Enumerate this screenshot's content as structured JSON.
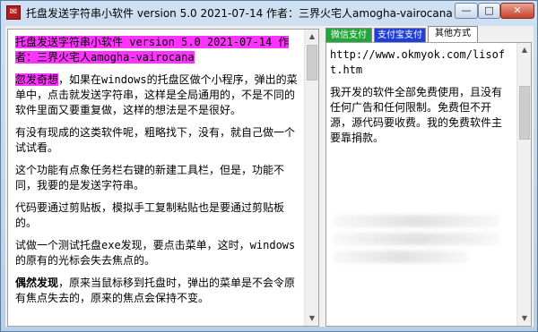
{
  "window": {
    "title": "托盘发送字符串小软件   version 5.0   2021-07-14   作者：三界火宅人amogha-vairocana",
    "icon_name": "app-icon",
    "minimize_glyph": "—",
    "maximize_glyph": "□",
    "close_glyph": "✕"
  },
  "left": {
    "header": "托盘发送字符串小软件     version 5.0    2021-07-14    作者：三界火宅人amogha-vairocana",
    "p1_lead": "忽发奇想",
    "p1_rest": "，如果在windows的托盘区做个小程序，弹出的菜单中，点击就发送字符串，这样是全局通用的，不是不同的软件里面又要重复做，这样的想法是不是很好。",
    "p2": "有没有现成的这类软件呢，粗略找下，没有，就自己做一个试试看。",
    "p3": "这个功能有点象任务栏右键的新建工具栏，但是，功能不同，我要的是发送字符串。",
    "p4": "代码要通过剪贴板，模拟手工复制粘贴也是要通过剪贴板的。",
    "p5": "试做一个测试托盘exe发现，要点击菜单，这时，windows的原有的光标会失去焦点的。",
    "p6_lead": "偶然发现",
    "p6_rest": "，原来当鼠标移到托盘时，弹出的菜单是不会令原有焦点失去的，原来的焦点会保持不变。",
    "highlight_color": "#ff33ff"
  },
  "right": {
    "tabs": [
      "微信支付",
      "支付宝支付",
      "其他方式"
    ],
    "active_tab": "其他方式",
    "url": "http://www.okmyok.com/lisoft.htm",
    "para": "我开发的软件全部免费使用，且没有任何广告和任何限制。免费但不开源，源代码要收费。我的免费软件主要靠捐款。",
    "tab_colors": [
      "#22a63a",
      "#1f3fd6",
      "#ffffff"
    ]
  }
}
